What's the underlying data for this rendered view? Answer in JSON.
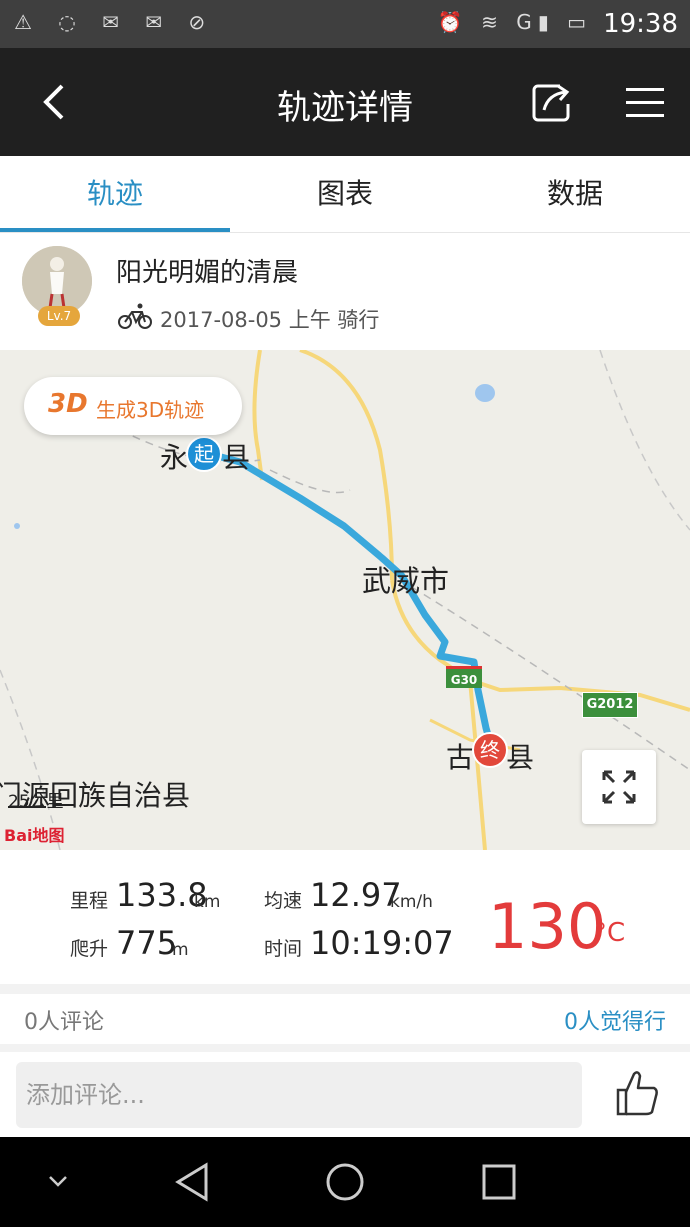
{
  "status_bar": {
    "time": "19:38",
    "network": "G"
  },
  "nav": {
    "title": "轨迹详情"
  },
  "tabs": [
    {
      "label": "轨迹",
      "active": true
    },
    {
      "label": "图表",
      "active": false
    },
    {
      "label": "数据",
      "active": false
    }
  ],
  "user": {
    "name": "阳光明媚的清晨",
    "level": "Lv.7",
    "date": "2017-08-05",
    "period": "上午",
    "activity": "骑行"
  },
  "map": {
    "button_3d": {
      "icon": "3D",
      "label": "生成3D轨迹"
    },
    "labels": {
      "start_city": "永",
      "start_suffix": "县",
      "start_marker": "起",
      "city": "武威市",
      "end_city": "古",
      "end_suffix": "县",
      "end_marker": "终",
      "county": "门源回族自治县"
    },
    "roads": {
      "g30": "G30",
      "g2012": "G2012"
    },
    "scale": "25公里",
    "logo": "Bai地图"
  },
  "stats": {
    "distance": {
      "label": "里程",
      "value": "133.8",
      "unit": "km"
    },
    "speed": {
      "label": "均速",
      "value": "12.97",
      "unit": "km/h"
    },
    "climb": {
      "label": "爬升",
      "value": "775",
      "unit": "m"
    },
    "time": {
      "label": "时间",
      "value": "10:19:07"
    },
    "temperature": {
      "value": "130",
      "unit": "°C"
    }
  },
  "social": {
    "comments": "0人评论",
    "likes": "0人觉得行",
    "input_placeholder": "添加评论..."
  },
  "colors": {
    "accent": "#2a8fc4",
    "temp": "#e33b3b",
    "route": "#3aa8dc",
    "orange": "#e8772e"
  }
}
